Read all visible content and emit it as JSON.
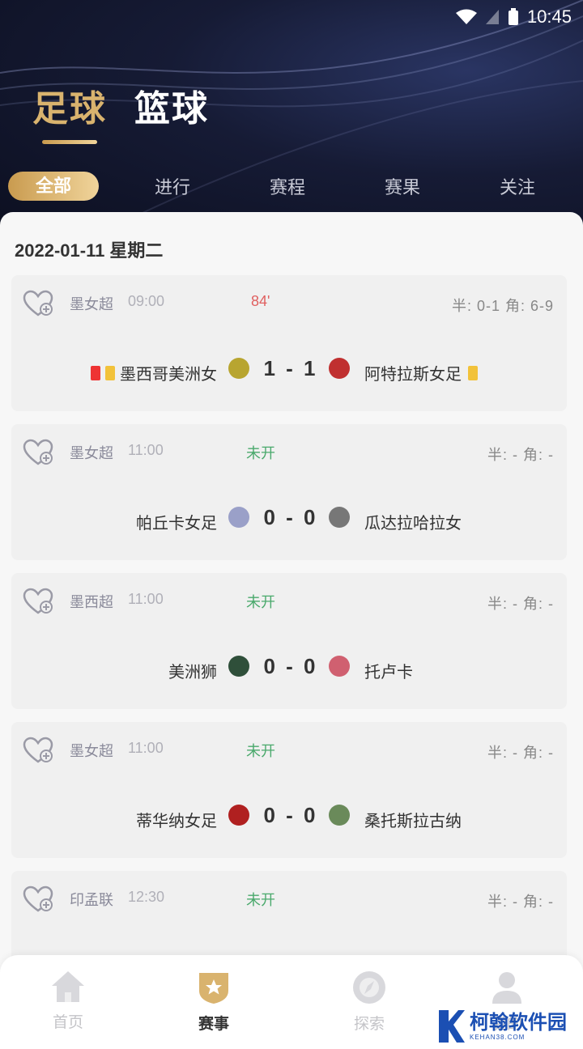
{
  "status_bar": {
    "time": "10:45"
  },
  "sport_tabs": [
    {
      "label": "足球",
      "active": true
    },
    {
      "label": "篮球",
      "active": false
    }
  ],
  "filter_tabs": [
    {
      "label": "全部",
      "active": true
    },
    {
      "label": "进行",
      "active": false
    },
    {
      "label": "赛程",
      "active": false
    },
    {
      "label": "赛果",
      "active": false
    },
    {
      "label": "关注",
      "active": false
    }
  ],
  "date_header": "2022-01-11 星期二",
  "matches": [
    {
      "league": "墨女超",
      "time": "09:00",
      "status": "84'",
      "live": true,
      "stats": "半: 0-1 角: 6-9",
      "home": "墨西哥美洲女",
      "away": "阿特拉斯女足",
      "score": "1 - 1",
      "home_cards": [
        "red",
        "yellow"
      ],
      "away_cards": [
        "yellow"
      ],
      "home_logo_color": "#b8a530",
      "away_logo_color": "#c03030"
    },
    {
      "league": "墨女超",
      "time": "11:00",
      "status": "未开",
      "live": false,
      "stats": "半: - 角: -",
      "home": "帕丘卡女足",
      "away": "瓜达拉哈拉女",
      "score": "0 - 0",
      "home_cards": [],
      "away_cards": [],
      "home_logo_color": "#9aa0c8",
      "away_logo_color": "#777777"
    },
    {
      "league": "墨西超",
      "time": "11:00",
      "status": "未开",
      "live": false,
      "stats": "半: - 角: -",
      "home": "美洲狮",
      "away": "托卢卡",
      "score": "0 - 0",
      "home_cards": [],
      "away_cards": [],
      "home_logo_color": "#2f4f3a",
      "away_logo_color": "#d06070"
    },
    {
      "league": "墨女超",
      "time": "11:00",
      "status": "未开",
      "live": false,
      "stats": "半: - 角: -",
      "home": "蒂华纳女足",
      "away": "桑托斯拉古纳",
      "score": "0 - 0",
      "home_cards": [],
      "away_cards": [],
      "home_logo_color": "#b02020",
      "away_logo_color": "#6a8a5a"
    },
    {
      "league": "印孟联",
      "time": "12:30",
      "status": "未开",
      "live": false,
      "stats": "半: - 角: -",
      "home": "",
      "away": "",
      "score": "",
      "home_cards": [],
      "away_cards": [],
      "home_logo_color": "",
      "away_logo_color": ""
    }
  ],
  "bottom_nav": [
    {
      "label": "首页",
      "icon": "home-icon",
      "active": false
    },
    {
      "label": "赛事",
      "icon": "star-shield-icon",
      "active": true
    },
    {
      "label": "探索",
      "icon": "compass-icon",
      "active": false
    },
    {
      "label": "我的",
      "icon": "user-icon",
      "active": false
    }
  ],
  "watermark": {
    "text": "柯翰软件园",
    "sub": "KEHAN38.COM"
  },
  "colors": {
    "accent_gold": "#d9b36e",
    "status_green": "#4aa96c",
    "live_red": "#e06060",
    "header_dark": "#161b35"
  }
}
